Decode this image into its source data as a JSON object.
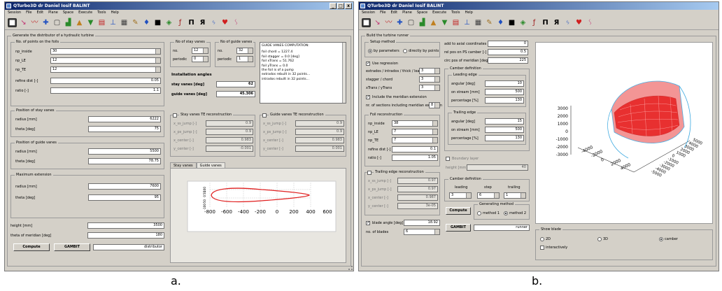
{
  "window_a": {
    "title": "QTurbo3D dr Daniel Iosif BALINT",
    "window_buttons": [
      "_",
      "□",
      "x"
    ],
    "menu": [
      "Session",
      "File",
      "Edit",
      "Plane",
      "Space",
      "Execute",
      "Tools",
      "Help"
    ],
    "frame_caption": "Generate the distributor of a hydraulic turbine",
    "foils_section": {
      "caption": "No. of points on the foils",
      "fields": [
        {
          "label": "np_inside",
          "value": "30"
        },
        {
          "label": "np_LE",
          "value": "12"
        },
        {
          "label": "np_TE",
          "value": "12"
        }
      ],
      "refine_label": "refine dist [-]",
      "refine_value": "0.05",
      "ratio_label": "ratio [-]",
      "ratio_value": "1.1"
    },
    "stay_pos": {
      "caption": "Position of stay vanes",
      "radius_label": "radius [mm]",
      "radius_value": "6222",
      "theta_label": "theta [deg]",
      "theta_value": "75"
    },
    "guide_pos": {
      "caption": "Position of guide vanes",
      "radius_label": "radius [mm]",
      "radius_value": "5500",
      "theta_label": "theta [deg]",
      "theta_value": "78.75"
    },
    "max_ext": {
      "caption": "Maximum extension",
      "radius_label": "radius [mm]",
      "radius_value": "7600",
      "theta_label": "theta [deg]",
      "theta_value": "95"
    },
    "height_label": "height [mm]",
    "height_value": "3500",
    "theta_merid_label": "theta of meridian [deg]",
    "theta_merid_value": "180",
    "compute_label": "Compute",
    "gambit_label": "GAMBIT",
    "name_value": "distributor",
    "stay_count": {
      "caption": "No of stay vanes",
      "no_label": "no.",
      "no_value": "12",
      "per_label": "periodic",
      "per_value": "0"
    },
    "guide_count": {
      "caption": "No of guide vanes",
      "no_label": "no.",
      "no_value": "32",
      "per_label": "periodic",
      "per_value": "1"
    },
    "install": {
      "caption": "Installation angles",
      "stay_label": "stay vanes [deg]",
      "stay_value": "62",
      "guide_label": "guide vanes [deg]",
      "guide_value": "45.306"
    },
    "log": {
      "title": "GUIDE VANES COMPUTATION:",
      "lines": [
        "foil chord = 1227.4",
        "foil stagger = 0.0 [deg]",
        "foil xTrans = 51.762",
        "foil yTrans = 0.0",
        "the foil is of a pump",
        "extrados rebuilt in 32 points...",
        "intrados rebuilt in 32 points..."
      ]
    },
    "stay_te": {
      "caption": "Stay vanes TE reconstruction",
      "rows": [
        {
          "label": "x_ss_jump [-]",
          "value": "0.9"
        },
        {
          "label": "x_ps_jump [-]",
          "value": "0.9"
        },
        {
          "label": "x_center [-]",
          "value": "0.983"
        },
        {
          "label": "y_center [-]",
          "value": "-0.001"
        }
      ]
    },
    "guide_te": {
      "caption": "Guide vanes TE reconstruction",
      "rows": [
        {
          "label": "x_ss_jump [-]",
          "value": "0.9"
        },
        {
          "label": "x_ps_jump [-]",
          "value": "0.9"
        },
        {
          "label": "x_center [-]",
          "value": "0.983"
        },
        {
          "label": "y_center [-]",
          "value": "0.001"
        }
      ]
    },
    "tabs": [
      "Stay vanes",
      "Guide vanes"
    ],
    "plot": {
      "x_ticks": [
        "-800",
        "-600",
        "-400",
        "-200",
        "0",
        "200",
        "400",
        "600"
      ],
      "y_ticks": [
        "100",
        "50",
        "0",
        "-50",
        "-100"
      ]
    }
  },
  "window_b": {
    "title": "QTurbo3D dr Daniel Iosif BALINT",
    "menu": [
      "Session",
      "File",
      "Edit",
      "Plane",
      "Space",
      "Execute",
      "Tools",
      "Help"
    ],
    "frame_caption": "Build the turbine runner",
    "setup": {
      "caption": "Setup method",
      "opt1": "by parameters",
      "opt2": "directly by points"
    },
    "regression_label": "Use regression",
    "reg_rows": [
      {
        "label": "extrados / intrados / thick / lead",
        "value": "3"
      },
      {
        "label": "stagger / chord",
        "value": "3"
      },
      {
        "label": "xTrans / yTrans",
        "value": "3"
      }
    ],
    "merid_label": "Include the meridian extension",
    "sections_label": "nr. of sections including meridian extension",
    "sections_value": "8",
    "foil_rec": {
      "caption": "Foil reconstruction",
      "rows": [
        {
          "label": "np_inside",
          "value": "38"
        },
        {
          "label": "np_LE",
          "value": "7"
        },
        {
          "label": "np_TE",
          "value": "7"
        }
      ],
      "refine_label": "refine dist [-]",
      "refine_value": "0.1",
      "ratio_label": "ratio [-]",
      "ratio_value": "1.05"
    },
    "te_rec": {
      "caption": "Trailing edge reconstruction",
      "rows": [
        {
          "label": "x_ss_jump [-]",
          "value": "0.97"
        },
        {
          "label": "x_ps_jump [-]",
          "value": "0.97"
        },
        {
          "label": "x_center [-]",
          "value": "0.987"
        },
        {
          "label": "y_center [-]",
          "value": "3e-05"
        }
      ]
    },
    "blade_angle_label": "blade angle [deg]",
    "blade_angle_value": "18.92",
    "blades_label": "no. of blades",
    "blades_value": "6",
    "add_axial_label": "add to axial coordinates",
    "add_axial_value": "0",
    "rel_pos_label": "rel pos on PS camber [-]",
    "rel_pos_value": "0.5",
    "circ_label": "circ pos of meridian [deg]",
    "circ_value": "225",
    "camber_def": {
      "caption": "Camber definition",
      "le_caption": "Leading edge",
      "le_rows": [
        {
          "label": "angular [deg]",
          "value": "10"
        },
        {
          "label": "on stream [mm]",
          "value": "500"
        },
        {
          "label": "percentage [%]",
          "value": "130"
        }
      ],
      "te_caption": "Trailing edge",
      "te_rows": [
        {
          "label": "angular [deg]",
          "value": "15"
        },
        {
          "label": "on stream [mm]",
          "value": "500"
        },
        {
          "label": "percentage [%]",
          "value": "130"
        }
      ]
    },
    "boundary_label": "Boundary layer",
    "height_label": "height [mm]",
    "height_value": "40",
    "camber_def2": {
      "caption": "Camber definition",
      "col_labels": [
        "leading",
        "step",
        "trailing"
      ],
      "col_values": [
        "3",
        "6",
        "1"
      ]
    },
    "compute_label": "Compute",
    "gen_caption": "Generating method",
    "method1": "method 1",
    "method2": "method 2",
    "gambit_label": "GAMBIT",
    "name_value": "runner",
    "show_blade": {
      "caption": "Show blade",
      "opts": [
        "2D",
        "3D",
        "camber"
      ],
      "inter_label": "interactively"
    },
    "plot": {
      "z_ticks": [
        "3000",
        "2000",
        "1000",
        "0",
        "-1000",
        "-2000",
        "-3000"
      ],
      "y_ticks": [
        "-4000",
        "-2000",
        "0",
        "2000",
        "4000"
      ],
      "x_ticks": [
        "5000",
        "4000",
        "3000",
        "2000",
        "1000",
        "0",
        "-1000",
        "-2000",
        "-3000",
        "-4000",
        "-5000"
      ]
    }
  },
  "captions": {
    "a": "a.",
    "b": "b."
  },
  "colors": {
    "title_bar": "#0a246a",
    "window_bg": "#d4d0c8",
    "profile": "#e02020",
    "mesh_red": "#e83030",
    "mesh_blue": "#3aa8e0"
  },
  "icons": [
    "cube-icon",
    "select-icon",
    "curve-icon",
    "move-icon",
    "box-icon",
    "chart-icon",
    "mountain-icon",
    "surface-icon",
    "layers-icon",
    "flag-icon",
    "file-icon",
    "pen-icon",
    "brush-icon",
    "palette-icon",
    "table-icon",
    "sheet-icon",
    "text-icon",
    "mirror-icon",
    "runner-icon",
    "heart-icon",
    "cursor-icon"
  ]
}
